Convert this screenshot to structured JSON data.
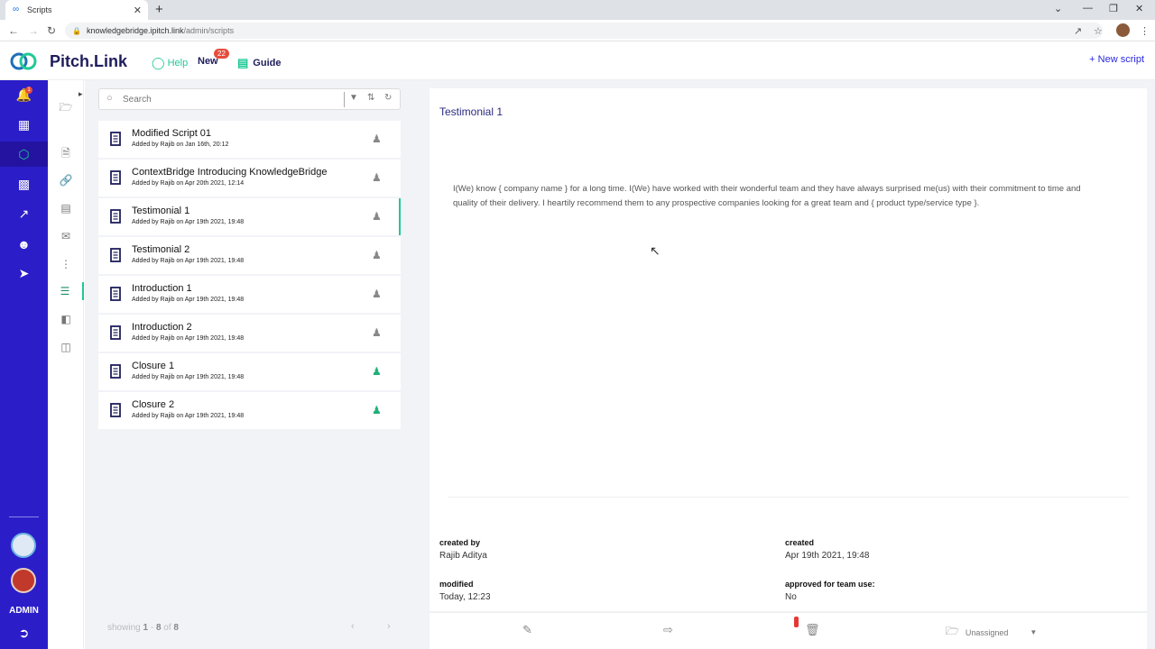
{
  "browser": {
    "tab_title": "Scripts",
    "url_host": "knowledgebridge.ipitch.link",
    "url_path": "/admin/scripts"
  },
  "header": {
    "logo": "Pitch.Link",
    "help_label": "Help",
    "new_label": "New",
    "new_badge": "22",
    "guide_label": "Guide",
    "new_script_label": "+ New script"
  },
  "sidebar": {
    "notification_count": "1",
    "admin_label": "ADMIN",
    "icons": [
      "bell-icon",
      "dashboard-icon",
      "cube-icon",
      "presentation-icon",
      "chart-icon",
      "team-icon",
      "arrow-circle-icon"
    ]
  },
  "rail": {
    "icons": [
      "folder-icon",
      "file-icon",
      "link-icon",
      "document-icon",
      "mail-icon",
      "flow-icon",
      "script-icon",
      "comment-icon",
      "clipboard-icon"
    ]
  },
  "search": {
    "placeholder": "Search"
  },
  "scripts": [
    {
      "title": "Modified Script 01",
      "sub": "Added by Rajib on Jan 16th, 20:12",
      "approved": false,
      "active": false
    },
    {
      "title": "ContextBridge Introducing KnowledgeBridge",
      "sub": "Added by Rajib on Apr 20th 2021, 12:14",
      "approved": false,
      "active": false
    },
    {
      "title": "Testimonial 1",
      "sub": "Added by Rajib on Apr 19th 2021, 19:48",
      "approved": false,
      "active": true
    },
    {
      "title": "Testimonial 2",
      "sub": "Added by Rajib on Apr 19th 2021, 19:48",
      "approved": false,
      "active": false
    },
    {
      "title": "Introduction 1",
      "sub": "Added by Rajib on Apr 19th 2021, 19:48",
      "approved": false,
      "active": false
    },
    {
      "title": "Introduction 2",
      "sub": "Added by Rajib on Apr 19th 2021, 19:48",
      "approved": false,
      "active": false
    },
    {
      "title": "Closure 1",
      "sub": "Added by Rajib on Apr 19th 2021, 19:48",
      "approved": true,
      "active": false
    },
    {
      "title": "Closure 2",
      "sub": "Added by Rajib on Apr 19th 2021, 19:48",
      "approved": true,
      "active": false
    }
  ],
  "pagination": {
    "showing": "showing",
    "from": "1",
    "dash": "-",
    "to": "8",
    "of": "of",
    "total": "8"
  },
  "detail": {
    "title": "Testimonial 1",
    "body": "I(We) know { company name } for a long time. I(We) have worked with their wonderful team and they have always surprised me(us) with their commitment to time and quality of their delivery. I heartily recommend them to any prospective companies looking for a great team and { product type/service type }.",
    "created_by_label": "created by",
    "created_by_value": "Rajib Aditya",
    "created_label": "created",
    "created_value": "Apr 19th 2021, 19:48",
    "modified_label": "modified",
    "modified_value": "Today, 12:23",
    "approved_label": "approved for team use:",
    "approved_value": "No",
    "folder_value": "Unassigned"
  },
  "colors": {
    "sidebar": "#2b1ec9",
    "accent_green": "#20c997",
    "brand_navy": "#1e1d5c"
  }
}
